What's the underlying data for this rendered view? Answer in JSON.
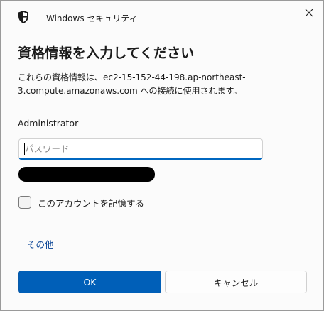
{
  "titlebar": {
    "app_name": "Windows セキュリティ",
    "icon": "shield-icon",
    "close_icon": "close-icon"
  },
  "heading": "資格情報を入力してください",
  "description": "これらの資格情報は、ec2-15-152-44-198.ap-northeast-3.compute.amazonaws.com への接続に使用されます。",
  "username": "Administrator",
  "password": {
    "placeholder": "パスワード",
    "value": ""
  },
  "remember": {
    "label": "このアカウントを記憶する",
    "checked": false
  },
  "more_choices": "その他",
  "buttons": {
    "ok": "OK",
    "cancel": "キャンセル"
  },
  "colors": {
    "accent": "#005fb8",
    "link": "#003e92",
    "redaction": "#000000"
  }
}
